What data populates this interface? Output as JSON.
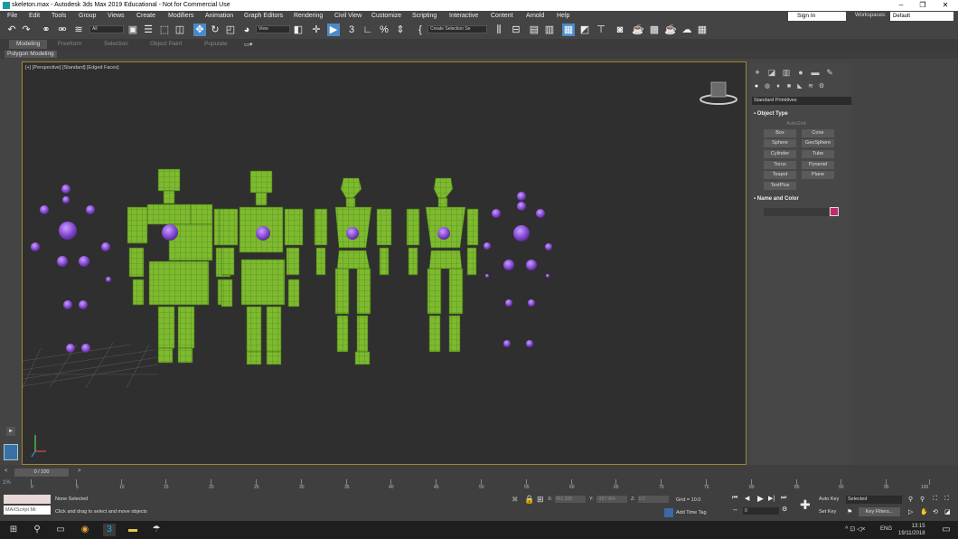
{
  "window": {
    "title": "skeleton.max - Autodesk 3ds Max 2019 Educational - Not for Commercial Use",
    "minimize": "–",
    "restore": "❐",
    "close": "✕"
  },
  "menubar": {
    "items": [
      "File",
      "Edit",
      "Tools",
      "Group",
      "Views",
      "Create",
      "Modifiers",
      "Animation",
      "Graph Editors",
      "Rendering",
      "Civil View",
      "Customize",
      "Scripting",
      "Interactive",
      "Content",
      "Arnold",
      "Help"
    ],
    "sign_in": "Sign In",
    "workspaces_label": "Workspaces:",
    "workspaces_value": "Default"
  },
  "toolbar": {
    "selection_filter": "All",
    "ref_coord": "View",
    "named_selection": "Create Selection Se",
    "snap_label": "3",
    "angle_snap": "%"
  },
  "ribbon": {
    "tabs": [
      "Modeling",
      "Freeform",
      "Selection",
      "Object Paint",
      "Populate"
    ],
    "active_tab": "Modeling",
    "sub_label": "Polygon Modeling"
  },
  "viewport": {
    "label": "[+] [Perspective] [Standard] [Edged Faces]"
  },
  "command_panel": {
    "primitive_type": "Standard Primitives",
    "object_type_title": "Object Type",
    "autogrid": "AutoGrid",
    "buttons": [
      "Box",
      "Cone",
      "Sphere",
      "GeoSphere",
      "Cylinder",
      "Tube",
      "Torus",
      "Pyramid",
      "Teapot",
      "Plane",
      "TextPlus"
    ],
    "name_color_title": "Name and Color",
    "object_color": "#c02a6e"
  },
  "timeline": {
    "slider": "0 / 100",
    "ticks": [
      "0",
      "5",
      "10",
      "15",
      "20",
      "25",
      "30",
      "35",
      "40",
      "45",
      "50",
      "55",
      "60",
      "65",
      "70",
      "75",
      "80",
      "85",
      "90",
      "95",
      "100"
    ]
  },
  "status": {
    "maxscript": "MAXScript Mi:",
    "selection": "None Selected",
    "prompt": "Click and drag to select and move objects",
    "x_label": "X:",
    "x_value": "462.308",
    "y_label": "Y:",
    "y_value": "-387.984",
    "z_label": "Z:",
    "z_value": "0.0",
    "grid": "Grid = 10.0",
    "add_time_tag": "Add Time Tag",
    "frame": "0",
    "auto_key": "Auto Key",
    "set_key": "Set Key",
    "selected": "Selected",
    "key_filters": "Key Filters..."
  },
  "taskbar": {
    "lang": "ENG",
    "time": "13:15",
    "date": "19/11/2018"
  }
}
